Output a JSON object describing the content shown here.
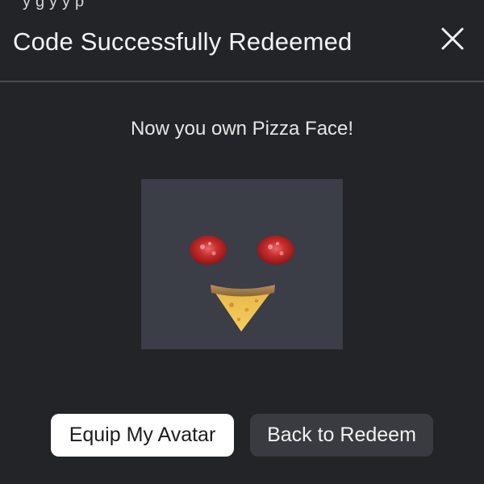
{
  "top_peek_text": "y   g       y       y  p",
  "modal": {
    "title": "Code Successfully Redeemed",
    "message": "Now you own Pizza Face!"
  },
  "item": {
    "icon": "pizza-face-icon"
  },
  "actions": {
    "equip_label": "Equip My Avatar",
    "back_label": "Back to Redeem"
  },
  "colors": {
    "background": "#232428",
    "thumbnail_bg": "#3b3d47",
    "primary_button": "#ffffff",
    "secondary_button": "#393b41"
  }
}
